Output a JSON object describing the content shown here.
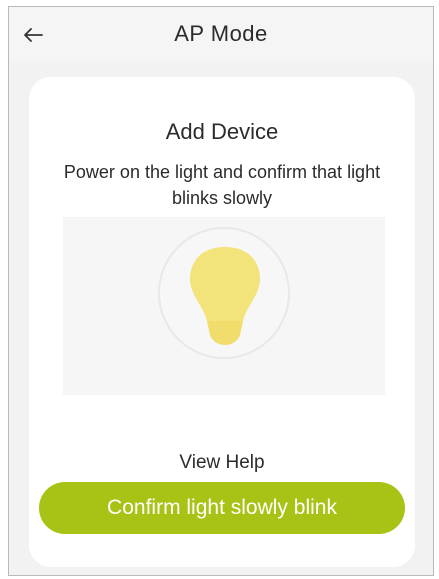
{
  "header": {
    "title": "AP Mode",
    "back_icon": "arrow-left-icon"
  },
  "card": {
    "title": "Add Device",
    "description": "Power on the light and confirm that light blinks slowly",
    "illustration_icon": "light-bulb-icon",
    "help_link": "View Help",
    "confirm_button": "Confirm light slowly blink"
  },
  "colors": {
    "accent": "#a8c316",
    "bulb": "#f2e37a",
    "background": "#f2f2f2",
    "card": "#ffffff"
  }
}
